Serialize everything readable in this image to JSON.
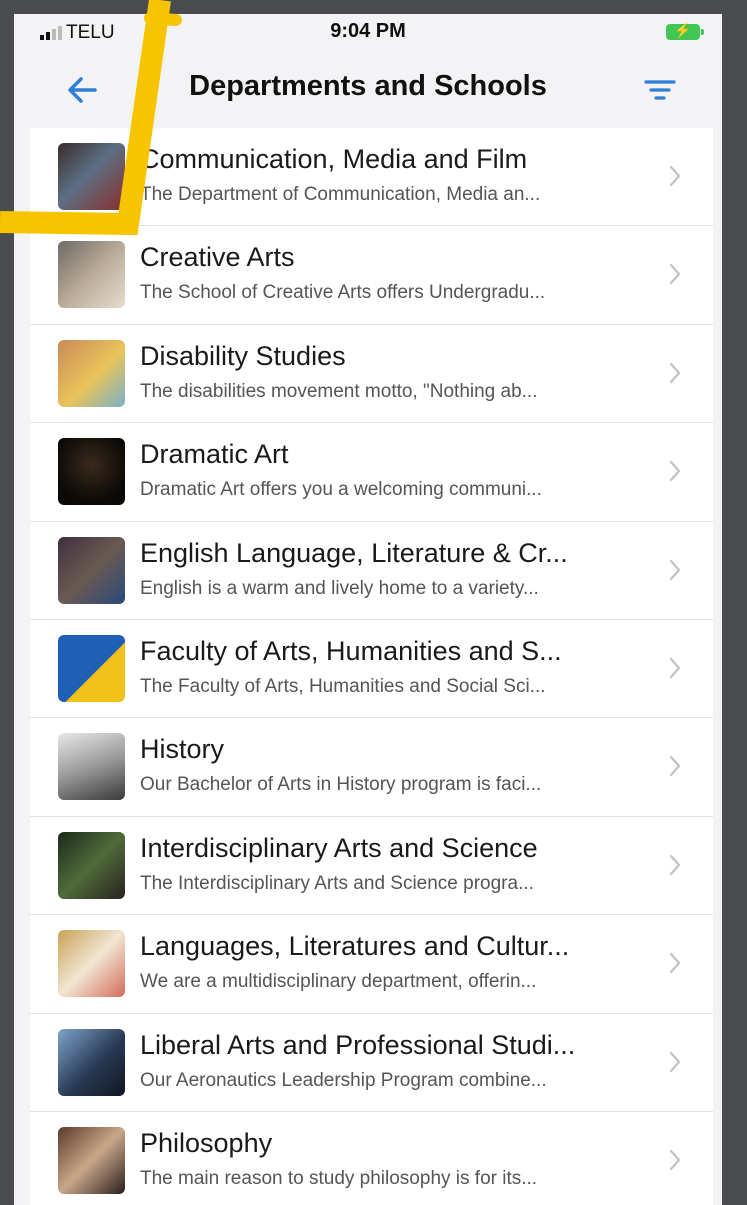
{
  "status": {
    "carrier": "TELU",
    "time": "9:04 PM",
    "battery_color": "#3fc653"
  },
  "header": {
    "title": "Departments and Schools",
    "back_icon": "arrow-left-icon",
    "filter_icon": "filter-icon",
    "accent": "#2f7fd6"
  },
  "items": [
    {
      "title": "Communication, Media and Film",
      "desc": "The Department of Communication, Media an..."
    },
    {
      "title": "Creative Arts",
      "desc": "The School of Creative Arts offers Undergradu..."
    },
    {
      "title": "Disability Studies",
      "desc": "The disabilities movement motto, \"Nothing ab..."
    },
    {
      "title": "Dramatic Art",
      "desc": "Dramatic Art offers you a welcoming communi..."
    },
    {
      "title": "English Language, Literature & Cr...",
      "desc": "English is a warm and lively home to a variety..."
    },
    {
      "title": "Faculty of Arts, Humanities and S...",
      "desc": "The Faculty of Arts, Humanities and Social Sci..."
    },
    {
      "title": "History",
      "desc": "Our Bachelor of Arts in History program is faci..."
    },
    {
      "title": "Interdisciplinary Arts and Science",
      "desc": "The Interdisciplinary Arts and Science progra..."
    },
    {
      "title": "Languages, Literatures and Cultur...",
      "desc": "We are a multidisciplinary department, offerin..."
    },
    {
      "title": "Liberal Arts and Professional Studi...",
      "desc": "Our Aeronautics Leadership Program combine..."
    },
    {
      "title": "Philosophy",
      "desc": "The main reason to study philosophy is for its..."
    }
  ]
}
